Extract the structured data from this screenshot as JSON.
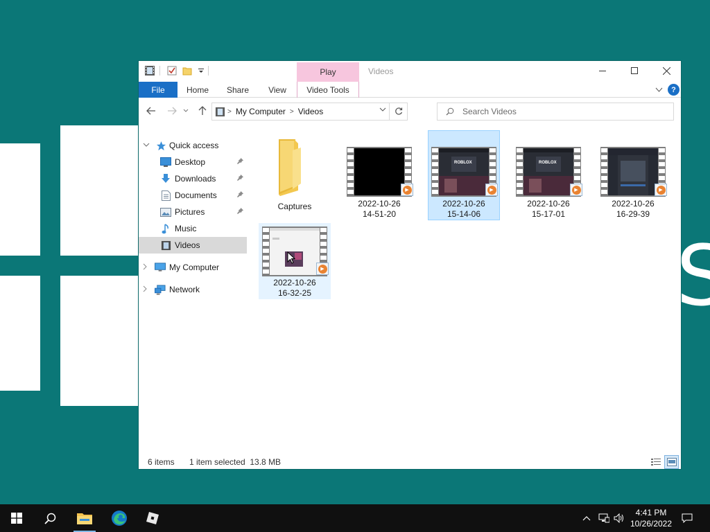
{
  "window": {
    "title": "Videos",
    "context_tab_group": "Play"
  },
  "ribbon": {
    "tabs": [
      "File",
      "Home",
      "Share",
      "View",
      "Video Tools"
    ],
    "help": "?"
  },
  "navigation": {
    "breadcrumb": [
      "My Computer",
      "Videos"
    ],
    "search_placeholder": "Search Videos"
  },
  "nav_pane": {
    "quick_access": "Quick access",
    "items": [
      {
        "label": "Desktop",
        "icon": "desktop-icon",
        "pinned": true
      },
      {
        "label": "Downloads",
        "icon": "downloads-icon",
        "pinned": true
      },
      {
        "label": "Documents",
        "icon": "documents-icon",
        "pinned": true
      },
      {
        "label": "Pictures",
        "icon": "pictures-icon",
        "pinned": true
      },
      {
        "label": "Music",
        "icon": "music-icon",
        "pinned": false
      },
      {
        "label": "Videos",
        "icon": "videos-icon",
        "pinned": false,
        "selected": true
      }
    ],
    "my_computer": "My Computer",
    "network": "Network"
  },
  "files": [
    {
      "name": "Captures",
      "type": "folder"
    },
    {
      "name": "2022-10-26\n14-51-20",
      "type": "video",
      "thumbnail": "black"
    },
    {
      "name": "2022-10-26\n15-14-06",
      "type": "video",
      "thumbnail": "roblox",
      "selected": true
    },
    {
      "name": "2022-10-26\n15-17-01",
      "type": "video",
      "thumbnail": "roblox"
    },
    {
      "name": "2022-10-26\n16-29-39",
      "type": "video",
      "thumbnail": "studio"
    },
    {
      "name": "2022-10-26\n16-32-25",
      "type": "video",
      "thumbnail": "light",
      "hover": true
    }
  ],
  "thumbnail_logo_text": "ROBLOX",
  "status": {
    "item_count": "6 items",
    "selection": "1 item selected  13.8 MB"
  },
  "taskbar": {
    "time": "4:41 PM",
    "date": "10/26/2022"
  },
  "colors": {
    "accent": "#1a6fc6",
    "context_tab": "#f7c6de",
    "selection": "#cce8ff",
    "desktop": "#0b7777",
    "taskbar": "#101010"
  }
}
